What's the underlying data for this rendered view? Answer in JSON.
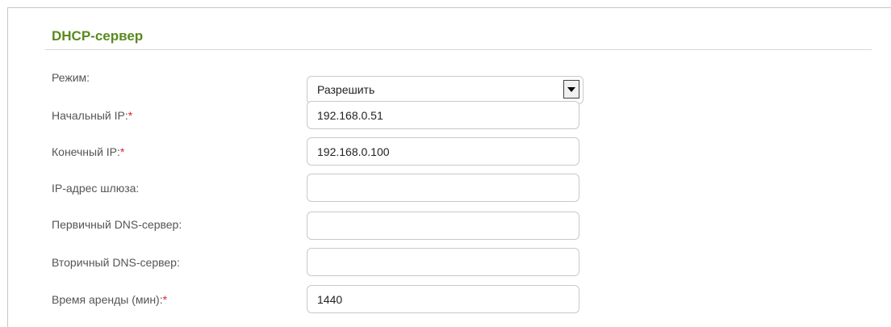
{
  "section": {
    "title": "DHCP-сервер"
  },
  "fields": {
    "mode": {
      "label": "Режим:",
      "value": "Разрешить"
    },
    "start_ip": {
      "label": "Начальный IP:",
      "required": "*",
      "value": "192.168.0.51"
    },
    "end_ip": {
      "label": "Конечный IP:",
      "required": "*",
      "value": "192.168.0.100"
    },
    "gateway": {
      "label": "IP-адрес шлюза:",
      "value": ""
    },
    "primary_dns": {
      "label": "Первичный DNS-сервер:",
      "value": ""
    },
    "secondary_dns": {
      "label": "Вторичный DNS-сервер:",
      "value": ""
    },
    "lease_time": {
      "label": "Время аренды (мин):",
      "required": "*",
      "value": "1440"
    }
  },
  "colors": {
    "title": "#5a8a1e",
    "required": "#e0202a",
    "label": "#555555"
  }
}
